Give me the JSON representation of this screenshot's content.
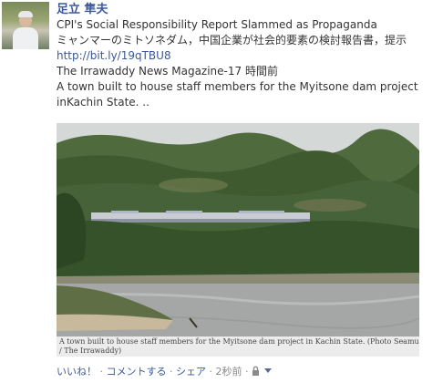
{
  "author": "足立 隼夫",
  "post": {
    "title": "CPI's Social Responsibility Report Slammed as Propaganda",
    "subtitle": "ミャンマーのミトソネダム，中国企業が社会的要素の検討報告書，提示",
    "link": "http://bit.ly/19qTBU8",
    "source": "The Irrawaddy News Magazine-17 時間前",
    "description_line1": "A town built to house staff members for the Myitsone dam project",
    "description_line2": "inKachin State. .."
  },
  "photo": {
    "caption_line1": "A town built to house staff members for the Myitsone dam project in Kachin State. (Photo Seamus Martov",
    "caption_line2": "/ The Irrawaddy)"
  },
  "actions": {
    "like": "いいね！",
    "comment": "コメントする",
    "share": "シェア",
    "time": "2秒前",
    "separator": " · "
  }
}
